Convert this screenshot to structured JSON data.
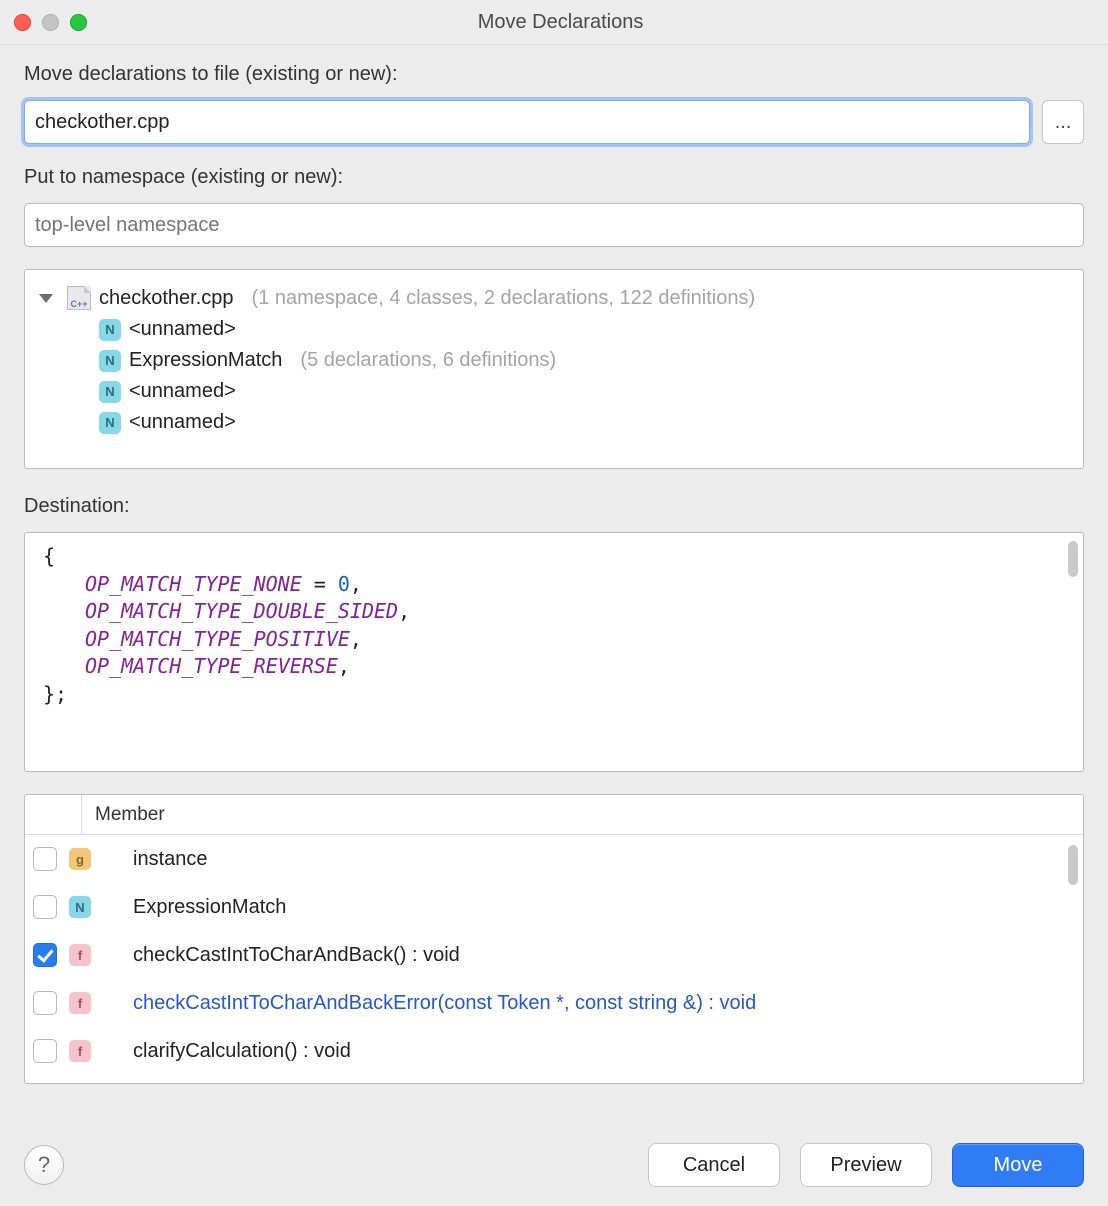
{
  "title": "Move Declarations",
  "labels": {
    "moveToFile": "Move declarations to file (existing or new):",
    "putToNamespace": "Put to namespace (existing or new):",
    "destination": "Destination:",
    "memberHeader": "Member"
  },
  "inputs": {
    "file": "checkother.cpp",
    "namespacePlaceholder": "top-level namespace"
  },
  "browseButton": "...",
  "tree": {
    "root": {
      "label": "checkother.cpp",
      "summary": "(1 namespace, 4 classes, 2 declarations, 122 definitions)"
    },
    "children": [
      {
        "badge": "N",
        "label": "<unnamed>",
        "summary": ""
      },
      {
        "badge": "N",
        "label": "ExpressionMatch",
        "summary": "(5 declarations, 6 definitions)"
      },
      {
        "badge": "N",
        "label": "<unnamed>",
        "summary": ""
      },
      {
        "badge": "N",
        "label": "<unnamed>",
        "summary": ""
      }
    ]
  },
  "destinationCode": {
    "open": "{",
    "lines": [
      {
        "name": "OP_MATCH_TYPE_NONE",
        "rhs": " = ",
        "zero": "0",
        "tail": ","
      },
      {
        "name": "OP_MATCH_TYPE_DOUBLE_SIDED",
        "rhs": "",
        "zero": "",
        "tail": ","
      },
      {
        "name": "OP_MATCH_TYPE_POSITIVE",
        "rhs": "",
        "zero": "",
        "tail": ","
      },
      {
        "name": "OP_MATCH_TYPE_REVERSE",
        "rhs": "",
        "zero": "",
        "tail": ","
      }
    ],
    "close": "};"
  },
  "members": [
    {
      "checked": false,
      "badge": "g",
      "text": "instance",
      "link": false
    },
    {
      "checked": false,
      "badge": "N",
      "text": "ExpressionMatch",
      "link": false
    },
    {
      "checked": true,
      "badge": "f",
      "text": "checkCastIntToCharAndBack() : void",
      "link": false
    },
    {
      "checked": false,
      "badge": "f",
      "text": "checkCastIntToCharAndBackError(const Token *, const string &) : void",
      "link": true
    },
    {
      "checked": false,
      "badge": "f",
      "text": "clarifyCalculation() : void",
      "link": false
    }
  ],
  "buttons": {
    "help": "?",
    "cancel": "Cancel",
    "preview": "Preview",
    "move": "Move"
  }
}
